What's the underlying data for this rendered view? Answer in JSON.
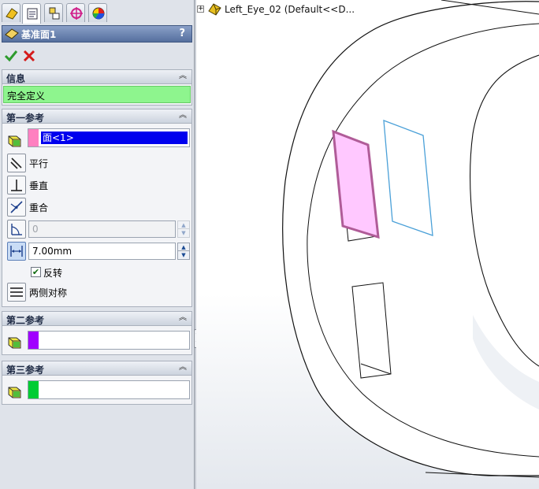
{
  "feature": {
    "title": "基准面1",
    "help_label": "?"
  },
  "colors": {
    "status_ok": "#8ef58e",
    "first_ref": "#ff80c0",
    "second_ref": "#a000ff",
    "third_ref": "#00cc33",
    "selection_highlight": "#0000ee"
  },
  "tabs": [
    {
      "icon": "feature-manager-icon"
    },
    {
      "icon": "property-manager-icon"
    },
    {
      "icon": "configuration-manager-icon"
    },
    {
      "icon": "dimxpert-icon"
    },
    {
      "icon": "display-manager-icon"
    }
  ],
  "info_group": {
    "title": "信息",
    "status": "完全定义"
  },
  "first_ref": {
    "title": "第一参考",
    "selection": "面<1>",
    "options": [
      "平行",
      "垂直",
      "重合"
    ],
    "angle_value": "0",
    "distance_value": "7.00mm",
    "flip_label": "反转",
    "flip_checked": true,
    "symmetric_label": "两侧对称"
  },
  "second_ref": {
    "title": "第二参考"
  },
  "third_ref": {
    "title": "第三参考"
  },
  "tree": {
    "part_name": "Left_Eye_02  (Default<<D..."
  }
}
